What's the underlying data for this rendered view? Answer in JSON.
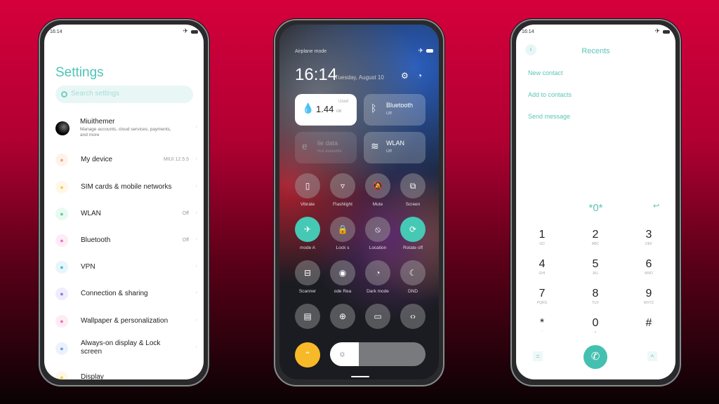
{
  "time": "16:14",
  "settings": {
    "title": "Settings",
    "search_placeholder": "Search settings",
    "account": {
      "name": "Miuithemer",
      "subtitle": "Manage accounts, cloud services, payments, and more"
    },
    "items": [
      {
        "label": "My device",
        "value": "MIUI 12.5.5",
        "icon": "phone-icon",
        "color": "#f7a07a"
      },
      {
        "label": "SIM cards & mobile networks",
        "value": "",
        "icon": "sim-icon",
        "color": "#f5cc4a"
      },
      {
        "label": "WLAN",
        "value": "Off",
        "icon": "wifi-icon",
        "color": "#5cd0a0"
      },
      {
        "label": "Bluetooth",
        "value": "Off",
        "icon": "bluetooth-icon",
        "color": "#ee6fc0"
      },
      {
        "label": "VPN",
        "value": "",
        "icon": "vpn-icon",
        "color": "#4cbcd0"
      },
      {
        "label": "Connection & sharing",
        "value": "",
        "icon": "connection-icon",
        "color": "#8a7ae8"
      },
      {
        "label": "Wallpaper & personalization",
        "value": "",
        "icon": "wallpaper-icon",
        "color": "#ee6fb8"
      },
      {
        "label": "Always-on display & Lock screen",
        "value": "",
        "icon": "lock-screen-icon",
        "color": "#6a9ae8"
      },
      {
        "label": "Display",
        "value": "",
        "icon": "display-icon",
        "color": "#f5cc4a"
      }
    ]
  },
  "control": {
    "status_label": "Airplane mode",
    "time": "16:14",
    "date": "Tuesday, August 10",
    "tiles": [
      {
        "title": "1.44",
        "unit": "GB",
        "sub": "Used",
        "icon": "water-drop-icon"
      },
      {
        "title": "Bluetooth",
        "sub": "Off",
        "icon": "bluetooth-icon"
      },
      {
        "title": "ile data",
        "sub": "Not available",
        "icon": "mobile-data-icon"
      },
      {
        "title": "WLAN",
        "sub": "Off",
        "icon": "wifi-icon"
      }
    ],
    "toggles": [
      {
        "label": "Vibrate",
        "icon": "vibrate-icon",
        "on": false
      },
      {
        "label": "Flashlight",
        "icon": "flashlight-icon",
        "on": false
      },
      {
        "label": "Mute",
        "icon": "mute-icon",
        "on": false
      },
      {
        "label": "Screen",
        "icon": "screenshot-icon",
        "on": false
      },
      {
        "label": "mode  A",
        "icon": "airplane-icon",
        "on": true
      },
      {
        "label": "Lock s",
        "icon": "lock-icon",
        "on": false
      },
      {
        "label": "Location",
        "icon": "location-icon",
        "on": false
      },
      {
        "label": "Rotate off",
        "icon": "rotate-icon",
        "on": true
      },
      {
        "label": "Scanner",
        "icon": "scanner-icon",
        "on": false
      },
      {
        "label": "ode   Rea",
        "icon": "reading-mode-icon",
        "on": false
      },
      {
        "label": "Dark mode",
        "icon": "dark-mode-icon",
        "on": false
      },
      {
        "label": "DND",
        "icon": "moon-icon",
        "on": false
      },
      {
        "label": "",
        "icon": "battery-saver-icon",
        "on": false
      },
      {
        "label": "",
        "icon": "battery-plus-icon",
        "on": false
      },
      {
        "label": "",
        "icon": "cast-icon",
        "on": false
      },
      {
        "label": "",
        "icon": "code-icon",
        "on": false
      }
    ],
    "brightness": 0.3,
    "accent": "#45c9b4",
    "auto_color": "#f7b928"
  },
  "dialer": {
    "title": "Recents",
    "links": [
      "New contact",
      "Add to contacts",
      "Send message"
    ],
    "entry": "*0*",
    "keys": [
      [
        "1",
        "GD"
      ],
      [
        "2",
        "ABC"
      ],
      [
        "3",
        "DEF"
      ],
      [
        "4",
        "GHI"
      ],
      [
        "5",
        "JKL"
      ],
      [
        "6",
        "MNO"
      ],
      [
        "7",
        "PQRS"
      ],
      [
        "8",
        "TUV"
      ],
      [
        "9",
        "WXYZ"
      ],
      [
        "*",
        "'"
      ],
      [
        "0",
        "+"
      ],
      [
        "#",
        ""
      ]
    ]
  }
}
